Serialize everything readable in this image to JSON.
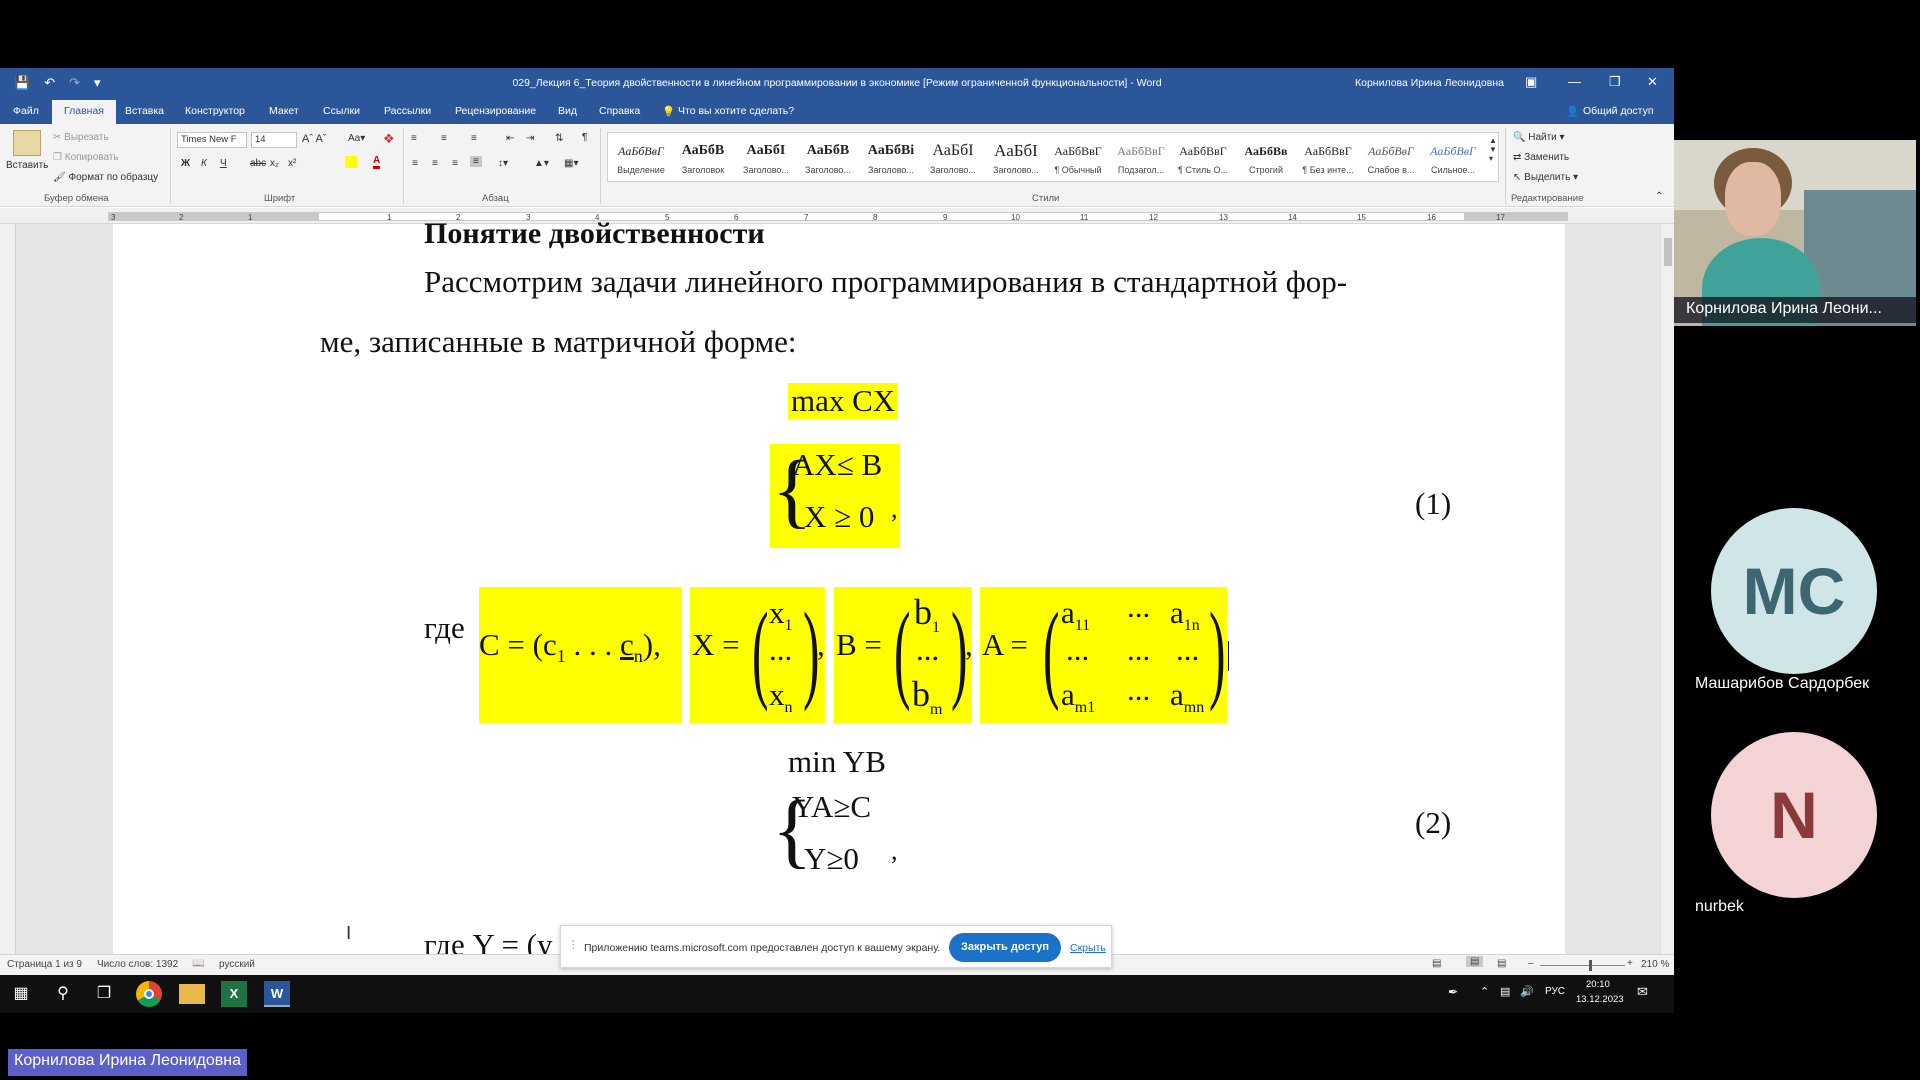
{
  "titlebar": {
    "title": "029_Лекция 6_Теория двойственности в линейном программировании в экономике [Режим ограниченной функциональности]  -  Word",
    "user": "Корнилова Ирина Леонидовна"
  },
  "tabs": [
    "Файл",
    "Главная",
    "Вставка",
    "Конструктор",
    "Макет",
    "Ссылки",
    "Рассылки",
    "Рецензирование",
    "Вид",
    "Справка"
  ],
  "tell_me": "Что вы хотите сделать?",
  "share": "Общий доступ",
  "ribbon": {
    "clipboard": {
      "paste": "Вставить",
      "cut": "Вырезать",
      "copy": "Копировать",
      "format_painter": "Формат по образцу",
      "label": "Буфер обмена"
    },
    "font": {
      "name": "Times New F",
      "size": "14",
      "label": "Шрифт"
    },
    "paragraph_label": "Абзац",
    "styles_label": "Стили",
    "styles": [
      {
        "sample": "АаБбВвГ",
        "name": "Выделение"
      },
      {
        "sample": "АаБбВ",
        "name": "Заголовок"
      },
      {
        "sample": "АаБбI",
        "name": "Заголово..."
      },
      {
        "sample": "АаБбВ",
        "name": "Заголово..."
      },
      {
        "sample": "АаБбВі",
        "name": "Заголово..."
      },
      {
        "sample": "АаБбI",
        "name": "Заголово..."
      },
      {
        "sample": "АаБбI",
        "name": "Заголово..."
      },
      {
        "sample": "АаБбВвГ",
        "name": "¶ Обычный"
      },
      {
        "sample": "АаБбВвГ",
        "name": "Подзагол..."
      },
      {
        "sample": "АаБбВвГ",
        "name": "¶ Стиль О..."
      },
      {
        "sample": "АаБбВв",
        "name": "Строгий"
      },
      {
        "sample": "АаБбВвГ",
        "name": "¶ Без инте..."
      },
      {
        "sample": "АаБбВвГ",
        "name": "Слабое в..."
      },
      {
        "sample": "АаБбВвГ",
        "name": "Сильное..."
      }
    ],
    "editing": {
      "find": "Найти",
      "replace": "Заменить",
      "select": "Выделить",
      "label": "Редактирование"
    }
  },
  "ruler_numbers": [
    "3",
    "2",
    "1",
    "1",
    "2",
    "3",
    "4",
    "5",
    "6",
    "7",
    "8",
    "9",
    "10",
    "11",
    "12",
    "13",
    "14",
    "15",
    "16",
    "17"
  ],
  "document": {
    "heading": "Понятие двойственности",
    "para_line1": "Рассмотрим задачи линейного программирования в стандартной фор-",
    "para_line2": "ме, записанные в матричной форме:",
    "max_expr": "max CX",
    "primal_c1": "AX≤ B",
    "primal_c2": "X ≥ 0",
    "eq1": "(1)",
    "where1": "где",
    "min_expr": "min YB",
    "dual_c1": "YA≥C",
    "dual_c2": "Y≥0",
    "eq2": "(2)",
    "where2": "где Y = (y"
  },
  "statusbar": {
    "page": "Страница 1 из 9",
    "words": "Число слов: 1392",
    "lang": "русский",
    "zoom": "210 %"
  },
  "banner": {
    "text": "Приложению teams.microsoft.com предоставлен доступ к вашему экрану.",
    "stop": "Закрыть доступ",
    "hide": "Скрыть"
  },
  "taskbar": {
    "lang": "РУС",
    "time": "20:10",
    "date": "13.12.2023"
  },
  "teams": {
    "presenter_video_name": "Корнилова Ирина Леони...",
    "participants": [
      {
        "initials": "MC",
        "name": "Машарибов Сардорбек",
        "color": "#cfe5e8",
        "text_color": "#3d6670"
      },
      {
        "initials": "N",
        "name": "nurbek",
        "color": "#f3d3d3",
        "text_color": "#8a3a3a"
      }
    ],
    "presenter_label": "Корнилова Ирина Леонидовна"
  },
  "colors": {
    "word_blue": "#2b579a",
    "highlight": "#ffff00",
    "teams_purple": "#5b5fc7"
  }
}
